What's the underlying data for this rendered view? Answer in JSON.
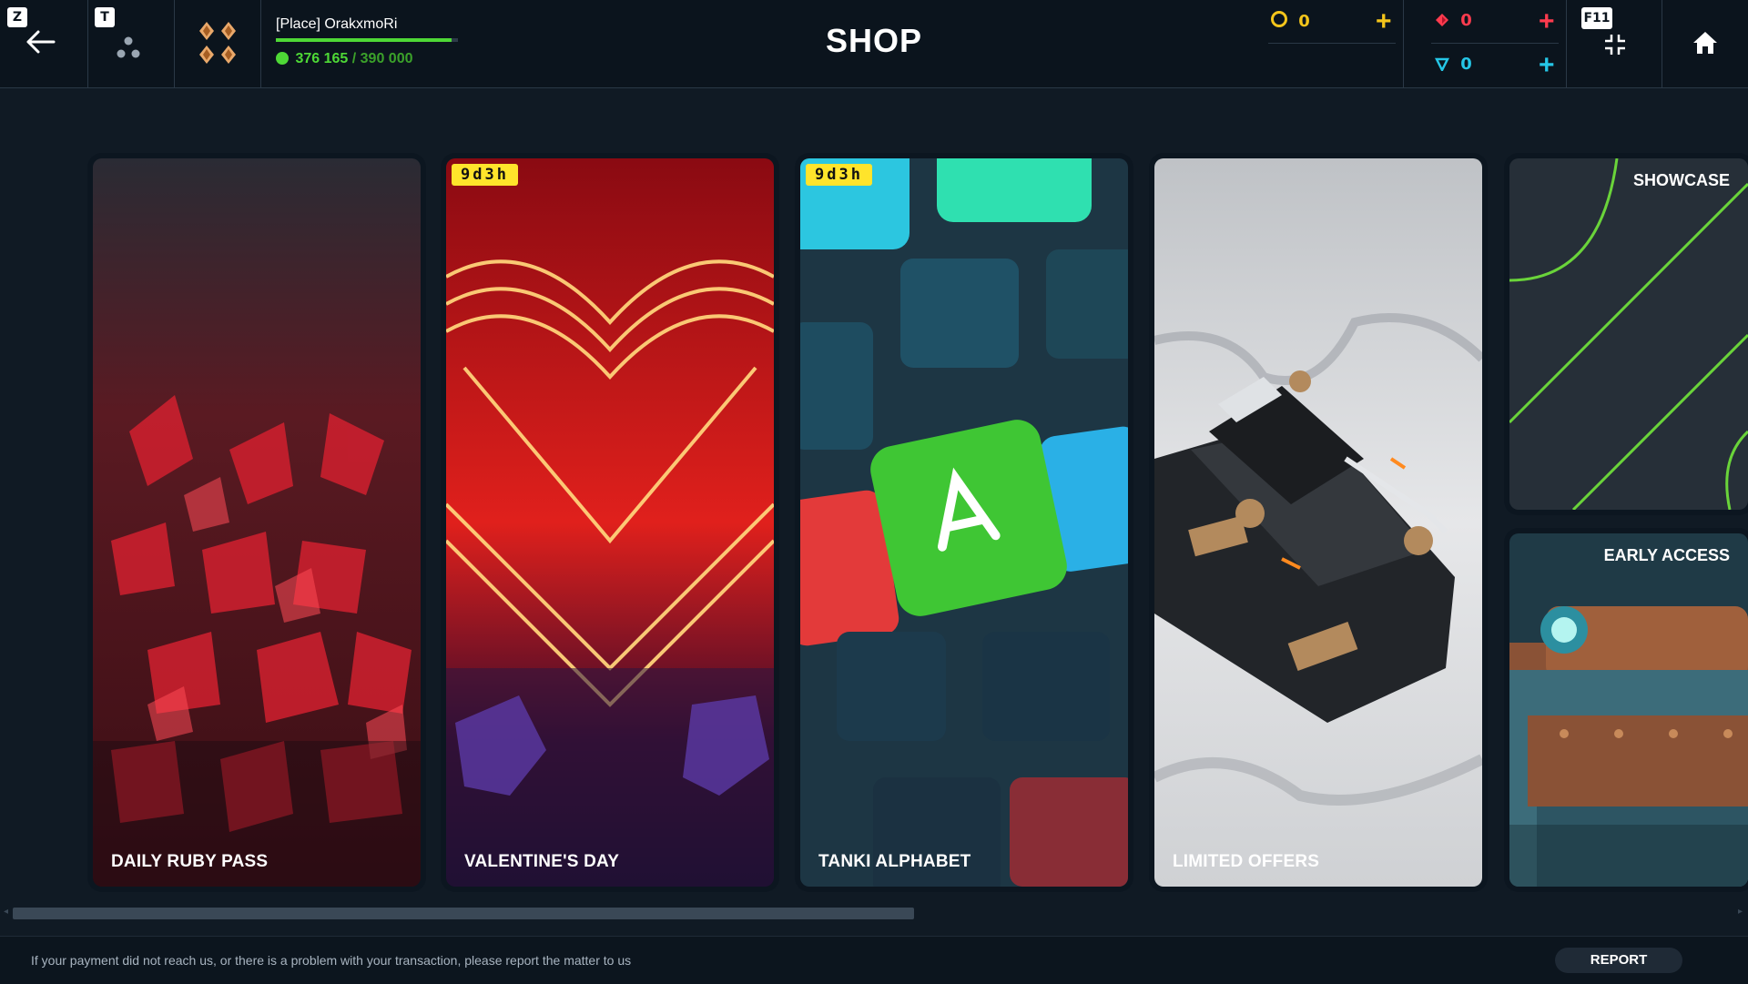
{
  "header": {
    "title": "SHOP",
    "back_key": "Z",
    "back_icon": "arrow-left-icon",
    "friends_key": "T",
    "friends_icon": "friends-icon",
    "rank_icon": "rank-diamonds-icon",
    "player_name": "[Place] OrakxmoRi",
    "xp_current": "376 165",
    "xp_separator": "/",
    "xp_max": "390 000",
    "xp_progress": 0.9645,
    "fullscreen_key": "F11",
    "fullscreen_icon": "fullscreen-icon",
    "home_icon": "home-icon"
  },
  "currency": {
    "crystals": {
      "icon": "crystal-coin-icon",
      "value": "0",
      "color": "#f4c51b"
    },
    "rubies": {
      "icon": "ruby-icon",
      "value": "0",
      "color": "#ff3b4e"
    },
    "tankoins": {
      "icon": "tankoin-icon",
      "value": "0",
      "color": "#25c6e6"
    },
    "plus_symbol": "+"
  },
  "cards": [
    {
      "label": "DAILY RUBY PASS",
      "timer": ""
    },
    {
      "label": "VALENTINE'S DAY",
      "timer": "9d3h"
    },
    {
      "label": "TANKI ALPHABET",
      "timer": "9d3h"
    },
    {
      "label": "LIMITED OFFERS",
      "timer": ""
    }
  ],
  "side_cards": [
    {
      "label": "SHOWCASE"
    },
    {
      "label": "EARLY ACCESS"
    }
  ],
  "footer": {
    "message": "If your payment did not reach us, or there is a problem with your transaction, please report the matter to us",
    "report_label": "REPORT"
  },
  "colors": {
    "accent_green": "#4ed836",
    "timer_badge": "#ffe42b",
    "background": "#101a24"
  }
}
